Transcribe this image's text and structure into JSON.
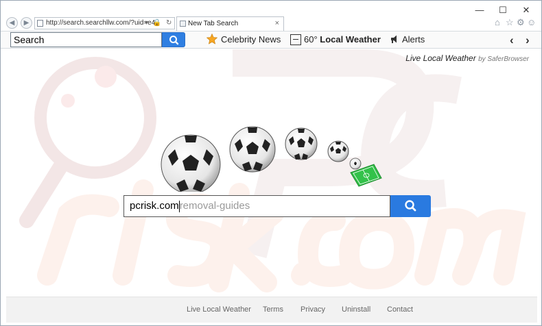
{
  "browser": {
    "address": "http://search.searchllw.com/?uid=e4",
    "tab_title": "New Tab Search",
    "tab_close": "×",
    "window_controls": {
      "minimize": "—",
      "maximize": "☐",
      "close": "✕"
    }
  },
  "toolbar": {
    "search_value": "Search",
    "celebrity_news": "Celebrity News",
    "temperature": "60°",
    "local_weather": "Local Weather",
    "alerts": "Alerts",
    "icons": {
      "search": "search-icon",
      "star": "star-icon",
      "weather": "weather-icon",
      "alerts": "alerts-icon"
    }
  },
  "main": {
    "brand": "Live Local Weather",
    "brand_by": "by SaferBrowser",
    "search_typed": "pcrisk.com",
    "search_ghost": "removal-guides"
  },
  "footer": {
    "links": [
      "Live Local Weather",
      "Terms",
      "Privacy",
      "Uninstall",
      "Contact"
    ]
  },
  "colors": {
    "accent": "#2a7ae0",
    "toolbar_bg": "#fafafa",
    "footer_bg": "#f2f2f2",
    "pitch": "#33c24a"
  }
}
